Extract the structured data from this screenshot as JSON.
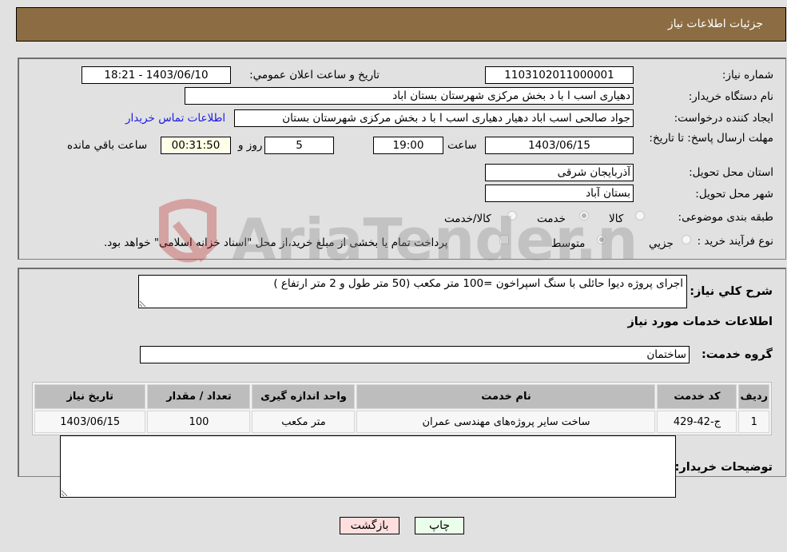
{
  "header": {
    "title": "جزئیات اطلاعات نیاز"
  },
  "fields": {
    "need_number": {
      "label": "شماره نیاز:",
      "value": "1103102011000001"
    },
    "announce_datetime": {
      "label": "تاریخ و ساعت اعلان عمومي:",
      "value": "1403/06/10 - 18:21"
    },
    "buyer_org": {
      "label": "نام دستگاه خریدار:",
      "value": "دهیاری اسب ا با د بخش مرکزی شهرستان بستان اباد"
    },
    "requester": {
      "label": "ایجاد کننده درخواست:",
      "value": "جواد صالحی اسب اباد دهیار دهیاری اسب ا با د بخش مرکزی شهرستان بستان",
      "contact_link": "اطلاعات تماس خریدار"
    },
    "deadline": {
      "label": "مهلت ارسال پاسخ: تا تاریخ:",
      "date": "1403/06/15",
      "time_label": "ساعت",
      "time": "19:00",
      "days": "5",
      "days_label": "روز و",
      "remaining": "00:31:50",
      "remaining_label": "ساعت باقي مانده"
    },
    "province": {
      "label": "استان محل تحویل:",
      "value": "آذربایجان شرقی"
    },
    "city": {
      "label": "شهر محل تحویل:",
      "value": "بستان آباد"
    },
    "category": {
      "label": "طبقه بندی موضوعی:",
      "options": [
        "کالا",
        "خدمت",
        "کالا/خدمت"
      ],
      "selected": "خدمت"
    },
    "purchase_type": {
      "label": "نوع فرآیند خرید :",
      "options": [
        "جزیي",
        "متوسط"
      ],
      "selected": "متوسط",
      "treasury_note": "پرداخت تمام یا بخشی از مبلغ خرید،از محل \"اسناد خزانه اسلامی\" خواهد بود."
    }
  },
  "description": {
    "label": "شرح کلي نیاز:",
    "value": "اجرای پروژه دیوا حائلی با سنگ اسپراخون =100 متر مکعب (50 متر طول و 2 متر ارتفاع )"
  },
  "services": {
    "section_title": "اطلاعات خدمات مورد نیاز",
    "group_label": "گروه خدمت:",
    "group_value": "ساختمان",
    "table": {
      "headers": [
        "ردیف",
        "کد خدمت",
        "نام خدمت",
        "واحد اندازه گیری",
        "تعداد / مقدار",
        "تاریخ نیاز"
      ],
      "rows": [
        [
          "1",
          "ج-42-429",
          "ساخت سایر پروژه‌های مهندسی عمران",
          "متر مکعب",
          "100",
          "1403/06/15"
        ]
      ]
    }
  },
  "buyer_notes": {
    "label": "توضیحات خریدار:",
    "value": ""
  },
  "buttons": {
    "print": "چاپ",
    "back": "بازگشت"
  },
  "watermark": {
    "text": "AriaTender.neT"
  }
}
